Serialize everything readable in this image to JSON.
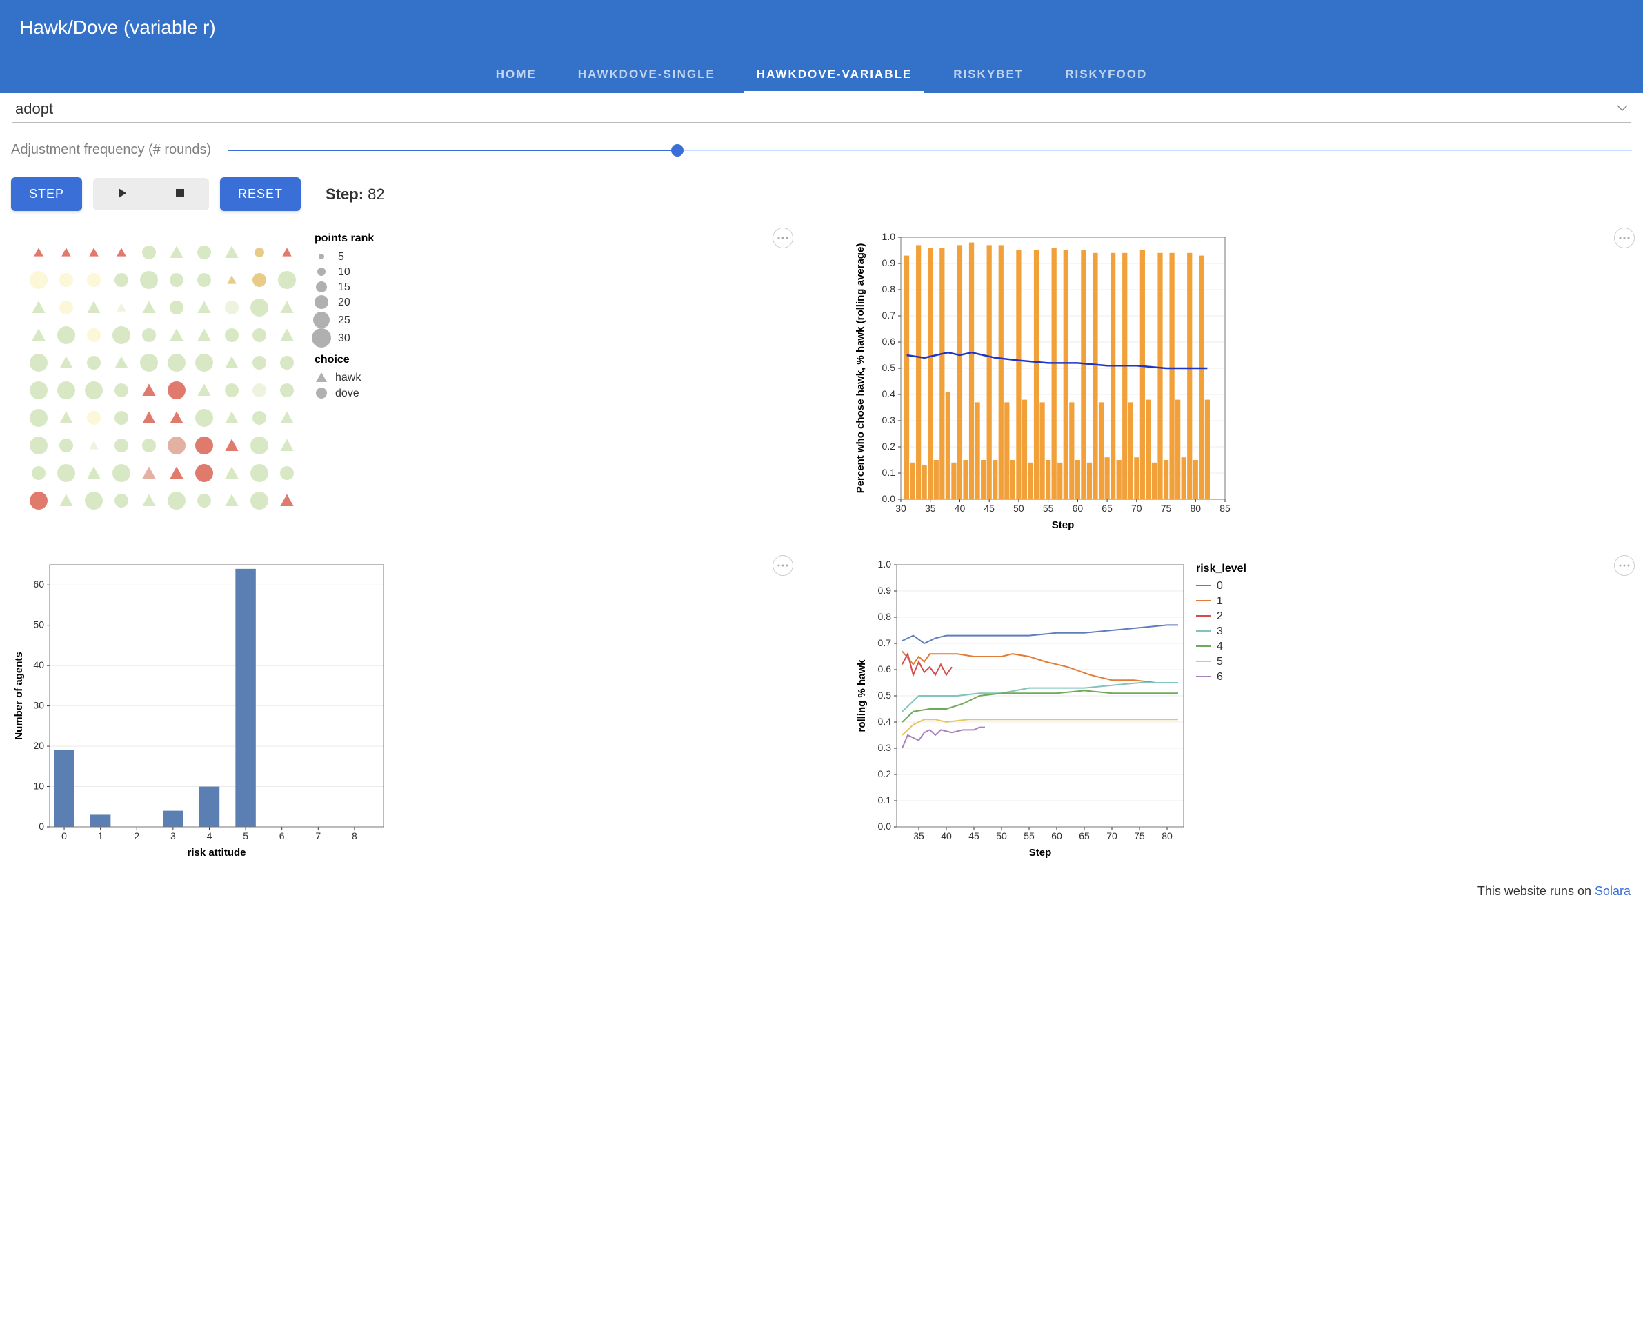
{
  "header": {
    "title": "Hawk/Dove (variable r)"
  },
  "tabs": {
    "items": [
      {
        "label": "HOME",
        "active": false
      },
      {
        "label": "HAWKDOVE-SINGLE",
        "active": false
      },
      {
        "label": "HAWKDOVE-VARIABLE",
        "active": true
      },
      {
        "label": "RISKYBET",
        "active": false
      },
      {
        "label": "RISKYFOOD",
        "active": false
      }
    ]
  },
  "select": {
    "value": "adopt"
  },
  "slider": {
    "label": "Adjustment frequency (# rounds)",
    "percent": 32
  },
  "controls": {
    "step_label": "STEP",
    "reset_label": "RESET",
    "step_caption": "Step:",
    "step_value": "82"
  },
  "grid_panel": {
    "legend_size_title": "points rank",
    "legend_choice_title": "choice",
    "legend_size_labels": [
      "5",
      "10",
      "15",
      "20",
      "25",
      "30"
    ],
    "legend_choice_labels": [
      "hawk",
      "dove"
    ],
    "cells": [
      [
        [
          "T",
          "red",
          1
        ],
        [
          "T",
          "red",
          1
        ],
        [
          "T",
          "red",
          1
        ],
        [
          "T",
          "red",
          1
        ],
        [
          "C",
          "green",
          2
        ],
        [
          "T",
          "green",
          2
        ],
        [
          "C",
          "green",
          2
        ],
        [
          "T",
          "green",
          2
        ],
        [
          "C",
          "tan",
          1
        ],
        [
          "T",
          "red",
          1
        ]
      ],
      [
        [
          "C",
          "paleyellow",
          3
        ],
        [
          "C",
          "paleyellow",
          2
        ],
        [
          "C",
          "paleyellow",
          2
        ],
        [
          "C",
          "green",
          2
        ],
        [
          "C",
          "green",
          3
        ],
        [
          "C",
          "green",
          2
        ],
        [
          "C",
          "green",
          2
        ],
        [
          "T",
          "tan",
          1
        ],
        [
          "C",
          "tan",
          2
        ],
        [
          "C",
          "green",
          3
        ]
      ],
      [
        [
          "T",
          "green",
          2
        ],
        [
          "C",
          "paleyellow",
          2
        ],
        [
          "T",
          "green",
          2
        ],
        [
          "T",
          "palegreen",
          1
        ],
        [
          "T",
          "green",
          2
        ],
        [
          "C",
          "green",
          2
        ],
        [
          "T",
          "green",
          2
        ],
        [
          "C",
          "palegreen",
          2
        ],
        [
          "C",
          "green",
          3
        ],
        [
          "T",
          "green",
          2
        ]
      ],
      [
        [
          "T",
          "green",
          2
        ],
        [
          "C",
          "green",
          3
        ],
        [
          "C",
          "paleyellow",
          2
        ],
        [
          "C",
          "green",
          3
        ],
        [
          "C",
          "green",
          2
        ],
        [
          "T",
          "green",
          2
        ],
        [
          "T",
          "green",
          2
        ],
        [
          "C",
          "green",
          2
        ],
        [
          "C",
          "green",
          2
        ],
        [
          "T",
          "green",
          2
        ]
      ],
      [
        [
          "C",
          "green",
          3
        ],
        [
          "T",
          "green",
          2
        ],
        [
          "C",
          "green",
          2
        ],
        [
          "T",
          "green",
          2
        ],
        [
          "C",
          "green",
          3
        ],
        [
          "C",
          "green",
          3
        ],
        [
          "C",
          "green",
          3
        ],
        [
          "T",
          "green",
          2
        ],
        [
          "C",
          "green",
          2
        ],
        [
          "C",
          "green",
          2
        ]
      ],
      [
        [
          "C",
          "green",
          3
        ],
        [
          "C",
          "green",
          3
        ],
        [
          "C",
          "green",
          3
        ],
        [
          "C",
          "green",
          2
        ],
        [
          "T",
          "red",
          2
        ],
        [
          "C",
          "red",
          3
        ],
        [
          "T",
          "green",
          2
        ],
        [
          "C",
          "green",
          2
        ],
        [
          "C",
          "palegreen",
          2
        ],
        [
          "C",
          "green",
          2
        ]
      ],
      [
        [
          "C",
          "green",
          3
        ],
        [
          "T",
          "green",
          2
        ],
        [
          "C",
          "paleyellow",
          2
        ],
        [
          "C",
          "green",
          2
        ],
        [
          "T",
          "red",
          2
        ],
        [
          "T",
          "red",
          2
        ],
        [
          "C",
          "green",
          3
        ],
        [
          "T",
          "green",
          2
        ],
        [
          "C",
          "green",
          2
        ],
        [
          "T",
          "green",
          2
        ]
      ],
      [
        [
          "C",
          "green",
          3
        ],
        [
          "C",
          "green",
          2
        ],
        [
          "T",
          "palegreen",
          1
        ],
        [
          "C",
          "green",
          2
        ],
        [
          "C",
          "green",
          2
        ],
        [
          "C",
          "pink",
          3
        ],
        [
          "C",
          "red",
          3
        ],
        [
          "T",
          "red",
          2
        ],
        [
          "C",
          "green",
          3
        ],
        [
          "T",
          "green",
          2
        ]
      ],
      [
        [
          "C",
          "green",
          2
        ],
        [
          "C",
          "green",
          3
        ],
        [
          "T",
          "green",
          2
        ],
        [
          "C",
          "green",
          3
        ],
        [
          "T",
          "pink",
          2
        ],
        [
          "T",
          "red",
          2
        ],
        [
          "C",
          "red",
          3
        ],
        [
          "T",
          "green",
          2
        ],
        [
          "C",
          "green",
          3
        ],
        [
          "C",
          "green",
          2
        ]
      ],
      [
        [
          "C",
          "red",
          3
        ],
        [
          "T",
          "green",
          2
        ],
        [
          "C",
          "green",
          3
        ],
        [
          "C",
          "green",
          2
        ],
        [
          "T",
          "green",
          2
        ],
        [
          "C",
          "green",
          3
        ],
        [
          "C",
          "green",
          2
        ],
        [
          "T",
          "green",
          2
        ],
        [
          "C",
          "green",
          3
        ],
        [
          "T",
          "red",
          2
        ]
      ]
    ]
  },
  "chart_data": [
    {
      "id": "percent_hawk",
      "type": "bar+line",
      "xlabel": "Step",
      "ylabel": "Percent who chose hawk, % hawk (rolling average)",
      "xticks": [
        30,
        35,
        40,
        45,
        50,
        55,
        60,
        65,
        70,
        75,
        80,
        85
      ],
      "yticks": [
        0.0,
        0.1,
        0.2,
        0.3,
        0.4,
        0.5,
        0.6,
        0.7,
        0.8,
        0.9,
        1.0
      ],
      "xlim": [
        30,
        85
      ],
      "ylim": [
        0,
        1
      ],
      "bars": {
        "x": [
          31,
          32,
          33,
          34,
          35,
          36,
          37,
          38,
          39,
          40,
          41,
          42,
          43,
          44,
          45,
          46,
          47,
          48,
          49,
          50,
          51,
          52,
          53,
          54,
          55,
          56,
          57,
          58,
          59,
          60,
          61,
          62,
          63,
          64,
          65,
          66,
          67,
          68,
          69,
          70,
          71,
          72,
          73,
          74,
          75,
          76,
          77,
          78,
          79,
          80,
          81,
          82
        ],
        "values": [
          0.93,
          0.14,
          0.97,
          0.13,
          0.96,
          0.15,
          0.96,
          0.41,
          0.14,
          0.97,
          0.15,
          0.98,
          0.37,
          0.15,
          0.97,
          0.15,
          0.97,
          0.37,
          0.15,
          0.95,
          0.38,
          0.14,
          0.95,
          0.37,
          0.15,
          0.96,
          0.14,
          0.95,
          0.37,
          0.15,
          0.95,
          0.14,
          0.94,
          0.37,
          0.16,
          0.94,
          0.15,
          0.94,
          0.37,
          0.16,
          0.95,
          0.38,
          0.14,
          0.94,
          0.15,
          0.94,
          0.38,
          0.16,
          0.94,
          0.15,
          0.93,
          0.38
        ],
        "color": "#f2a13a"
      },
      "line": {
        "x": [
          31,
          34,
          36,
          38,
          40,
          42,
          44,
          46,
          50,
          55,
          60,
          65,
          70,
          75,
          80,
          82
        ],
        "values": [
          0.55,
          0.54,
          0.55,
          0.56,
          0.55,
          0.56,
          0.55,
          0.54,
          0.53,
          0.52,
          0.52,
          0.51,
          0.51,
          0.5,
          0.5,
          0.5
        ],
        "color": "#1f35c6"
      }
    },
    {
      "id": "risk_histogram",
      "type": "bar",
      "xlabel": "risk attitude",
      "ylabel": "Number of agents",
      "xticks": [
        0,
        1,
        2,
        3,
        4,
        5,
        6,
        7,
        8
      ],
      "yticks": [
        0,
        10,
        20,
        30,
        40,
        50,
        60
      ],
      "categories": [
        0,
        1,
        2,
        3,
        4,
        5,
        6,
        7,
        8
      ],
      "values": [
        19,
        3,
        0,
        4,
        10,
        64,
        0,
        0,
        0
      ],
      "color": "#5b7fb2"
    },
    {
      "id": "rolling_by_risk",
      "type": "line",
      "xlabel": "Step",
      "ylabel": "rolling % hawk",
      "xticks": [
        35,
        40,
        45,
        50,
        55,
        60,
        65,
        70,
        75,
        80
      ],
      "yticks": [
        0.0,
        0.1,
        0.2,
        0.3,
        0.4,
        0.5,
        0.6,
        0.7,
        0.8,
        0.9,
        1.0
      ],
      "xlim": [
        31,
        83
      ],
      "ylim": [
        0,
        1
      ],
      "legend_title": "risk_level",
      "series": [
        {
          "name": "0",
          "color": "#5f7cbb",
          "x": [
            32,
            34,
            36,
            38,
            40,
            42,
            45,
            50,
            55,
            60,
            65,
            70,
            75,
            80,
            82
          ],
          "y": [
            0.71,
            0.73,
            0.7,
            0.72,
            0.73,
            0.73,
            0.73,
            0.73,
            0.73,
            0.74,
            0.74,
            0.75,
            0.76,
            0.77,
            0.77
          ]
        },
        {
          "name": "1",
          "color": "#e27c38",
          "x": [
            32,
            34,
            35,
            36,
            37,
            39,
            42,
            45,
            48,
            50,
            52,
            55,
            58,
            62,
            66,
            70,
            74,
            78,
            82
          ],
          "y": [
            0.67,
            0.62,
            0.65,
            0.63,
            0.66,
            0.66,
            0.66,
            0.65,
            0.65,
            0.65,
            0.66,
            0.65,
            0.63,
            0.61,
            0.58,
            0.56,
            0.56,
            0.55,
            0.55
          ]
        },
        {
          "name": "2",
          "color": "#d44b4b",
          "x": [
            32,
            33,
            34,
            35,
            36,
            37,
            38,
            39,
            40,
            41
          ],
          "y": [
            0.62,
            0.66,
            0.58,
            0.63,
            0.59,
            0.61,
            0.58,
            0.62,
            0.58,
            0.61
          ]
        },
        {
          "name": "3",
          "color": "#7fc5bb",
          "x": [
            32,
            35,
            38,
            42,
            46,
            50,
            55,
            60,
            65,
            70,
            75,
            80,
            82
          ],
          "y": [
            0.44,
            0.5,
            0.5,
            0.5,
            0.51,
            0.51,
            0.53,
            0.53,
            0.53,
            0.54,
            0.55,
            0.55,
            0.55
          ]
        },
        {
          "name": "4",
          "color": "#6faa58",
          "x": [
            32,
            34,
            37,
            40,
            43,
            46,
            50,
            55,
            60,
            65,
            70,
            75,
            80,
            82
          ],
          "y": [
            0.4,
            0.44,
            0.45,
            0.45,
            0.47,
            0.5,
            0.51,
            0.51,
            0.51,
            0.52,
            0.51,
            0.51,
            0.51,
            0.51
          ]
        },
        {
          "name": "5",
          "color": "#e6c75c",
          "x": [
            32,
            34,
            36,
            38,
            40,
            44,
            48,
            55,
            60,
            65,
            70,
            75,
            80,
            82
          ],
          "y": [
            0.35,
            0.39,
            0.41,
            0.41,
            0.4,
            0.41,
            0.41,
            0.41,
            0.41,
            0.41,
            0.41,
            0.41,
            0.41,
            0.41
          ]
        },
        {
          "name": "6",
          "color": "#a883b9",
          "x": [
            32,
            33,
            35,
            36,
            37,
            38,
            39,
            41,
            43,
            45,
            46,
            47
          ],
          "y": [
            0.3,
            0.35,
            0.33,
            0.36,
            0.37,
            0.35,
            0.37,
            0.36,
            0.37,
            0.37,
            0.38,
            0.38
          ]
        }
      ]
    }
  ],
  "footer": {
    "prefix": "This website runs on ",
    "link_text": "Solara"
  }
}
